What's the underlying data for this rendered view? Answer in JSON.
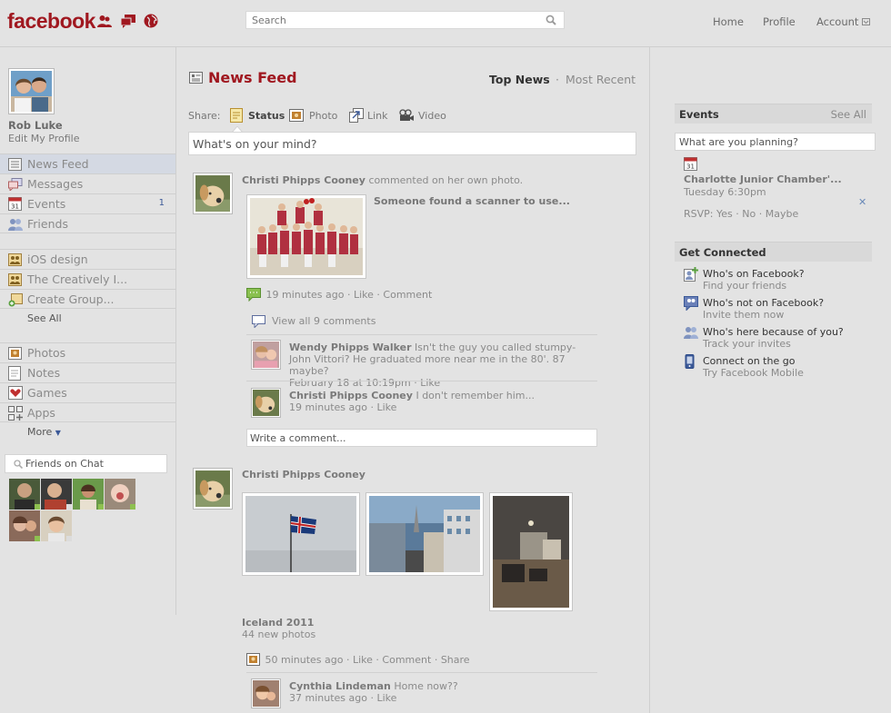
{
  "top": {
    "logo": "facebook",
    "search_placeholder": "Search",
    "nav": [
      "Home",
      "Profile",
      "Account"
    ]
  },
  "profile": {
    "name": "Rob Luke",
    "edit": "Edit My Profile"
  },
  "sidebar": {
    "items": [
      {
        "label": "News Feed",
        "icon": "news-feed-icon"
      },
      {
        "label": "Messages",
        "icon": "messages-icon"
      },
      {
        "label": "Events",
        "icon": "events-icon",
        "badge": "1"
      },
      {
        "label": "Friends",
        "icon": "friends-icon"
      }
    ],
    "groups": [
      {
        "label": "iOS design",
        "icon": "group-icon"
      },
      {
        "label": "The Creatively I...",
        "icon": "group-icon"
      },
      {
        "label": "Create Group...",
        "icon": "create-group-icon"
      }
    ],
    "see_all": "See All",
    "apps": [
      {
        "label": "Photos",
        "icon": "photos-icon"
      },
      {
        "label": "Notes",
        "icon": "notes-icon"
      },
      {
        "label": "Games",
        "icon": "games-icon"
      },
      {
        "label": "Apps",
        "icon": "apps-icon"
      }
    ],
    "more": "More",
    "chat_placeholder": "Friends on Chat"
  },
  "feed": {
    "title": "News Feed",
    "top_news": "Top News",
    "separator": "·",
    "most_recent": "Most Recent",
    "share_label": "Share:",
    "share_options": [
      "Status",
      "Photo",
      "Link",
      "Video"
    ],
    "status_placeholder": "What's on your mind?",
    "story1": {
      "author": "Christi Phipps Cooney",
      "action": "commented on her own photo.",
      "caption": "Someone found a scanner to use...",
      "meta_time": "19 minutes ago",
      "like": "Like",
      "comment": "Comment",
      "view_all": "View all 9 comments",
      "comments": [
        {
          "author": "Wendy Phipps Walker",
          "text": "Isn't the guy you called stumpy- John Vittori? He graduated more near me in the 80'. 87 maybe?",
          "time": "February 18 at 10:19pm",
          "like": "Like"
        },
        {
          "author": "Christi Phipps Cooney",
          "text": "I don't remember him...",
          "time": "19 minutes ago",
          "like": "Like"
        }
      ],
      "write_comment": "Write a comment..."
    },
    "story2": {
      "author": "Christi Phipps Cooney",
      "album": "Iceland 2011",
      "count": "44 new photos",
      "meta_time": "50 minutes ago",
      "like": "Like",
      "comment": "Comment",
      "share": "Share",
      "comment1": {
        "author": "Cynthia Lindeman",
        "text": "Home now??",
        "time": "37 minutes ago",
        "like": "Like"
      }
    }
  },
  "right": {
    "events_title": "Events",
    "events_see_all": "See All",
    "events_placeholder": "What are you planning?",
    "event": {
      "day": "31",
      "name": "Charlotte Junior Chamber'...",
      "time": "Tuesday 6:30pm",
      "rsvp": "RSVP:",
      "yes": "Yes",
      "no": "No",
      "maybe": "Maybe"
    },
    "connected_title": "Get Connected",
    "connected": [
      {
        "title": "Who's on Facebook?",
        "sub": "Find your friends",
        "icon": "add-friend-icon"
      },
      {
        "title": "Who's not on Facebook?",
        "sub": "Invite them now",
        "icon": "invite-icon"
      },
      {
        "title": "Who's here because of you?",
        "sub": "Track your invites",
        "icon": "friends-icon"
      },
      {
        "title": "Connect on the go",
        "sub": "Try Facebook Mobile",
        "icon": "mobile-icon"
      }
    ]
  },
  "colors": {
    "brand": "#a01820",
    "link": "#3b5998",
    "background": "#e3e3e3"
  }
}
